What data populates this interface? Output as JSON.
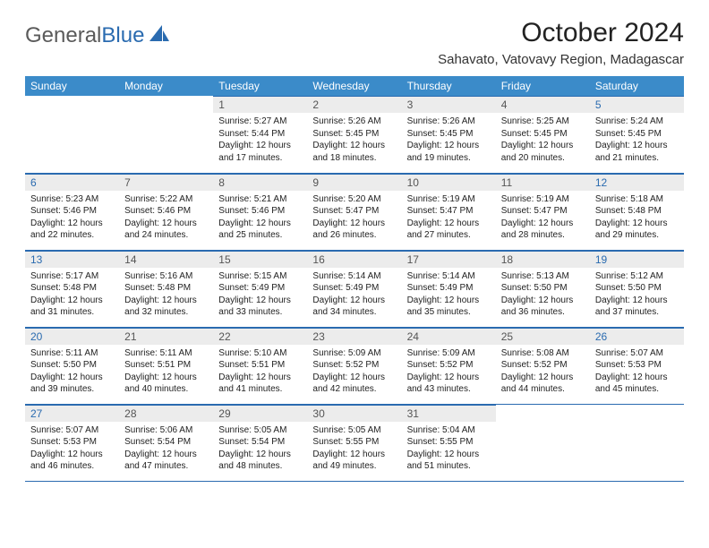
{
  "logo": {
    "part1": "General",
    "part2": "Blue"
  },
  "title": "October 2024",
  "location": "Sahavato, Vatovavy Region, Madagascar",
  "weekdays": [
    "Sunday",
    "Monday",
    "Tuesday",
    "Wednesday",
    "Thursday",
    "Friday",
    "Saturday"
  ],
  "weeks": [
    [
      {
        "day": "",
        "sunrise": "",
        "sunset": "",
        "daylight": ""
      },
      {
        "day": "",
        "sunrise": "",
        "sunset": "",
        "daylight": ""
      },
      {
        "day": "1",
        "sunrise": "Sunrise: 5:27 AM",
        "sunset": "Sunset: 5:44 PM",
        "daylight": "Daylight: 12 hours and 17 minutes."
      },
      {
        "day": "2",
        "sunrise": "Sunrise: 5:26 AM",
        "sunset": "Sunset: 5:45 PM",
        "daylight": "Daylight: 12 hours and 18 minutes."
      },
      {
        "day": "3",
        "sunrise": "Sunrise: 5:26 AM",
        "sunset": "Sunset: 5:45 PM",
        "daylight": "Daylight: 12 hours and 19 minutes."
      },
      {
        "day": "4",
        "sunrise": "Sunrise: 5:25 AM",
        "sunset": "Sunset: 5:45 PM",
        "daylight": "Daylight: 12 hours and 20 minutes."
      },
      {
        "day": "5",
        "sunrise": "Sunrise: 5:24 AM",
        "sunset": "Sunset: 5:45 PM",
        "daylight": "Daylight: 12 hours and 21 minutes."
      }
    ],
    [
      {
        "day": "6",
        "sunrise": "Sunrise: 5:23 AM",
        "sunset": "Sunset: 5:46 PM",
        "daylight": "Daylight: 12 hours and 22 minutes."
      },
      {
        "day": "7",
        "sunrise": "Sunrise: 5:22 AM",
        "sunset": "Sunset: 5:46 PM",
        "daylight": "Daylight: 12 hours and 24 minutes."
      },
      {
        "day": "8",
        "sunrise": "Sunrise: 5:21 AM",
        "sunset": "Sunset: 5:46 PM",
        "daylight": "Daylight: 12 hours and 25 minutes."
      },
      {
        "day": "9",
        "sunrise": "Sunrise: 5:20 AM",
        "sunset": "Sunset: 5:47 PM",
        "daylight": "Daylight: 12 hours and 26 minutes."
      },
      {
        "day": "10",
        "sunrise": "Sunrise: 5:19 AM",
        "sunset": "Sunset: 5:47 PM",
        "daylight": "Daylight: 12 hours and 27 minutes."
      },
      {
        "day": "11",
        "sunrise": "Sunrise: 5:19 AM",
        "sunset": "Sunset: 5:47 PM",
        "daylight": "Daylight: 12 hours and 28 minutes."
      },
      {
        "day": "12",
        "sunrise": "Sunrise: 5:18 AM",
        "sunset": "Sunset: 5:48 PM",
        "daylight": "Daylight: 12 hours and 29 minutes."
      }
    ],
    [
      {
        "day": "13",
        "sunrise": "Sunrise: 5:17 AM",
        "sunset": "Sunset: 5:48 PM",
        "daylight": "Daylight: 12 hours and 31 minutes."
      },
      {
        "day": "14",
        "sunrise": "Sunrise: 5:16 AM",
        "sunset": "Sunset: 5:48 PM",
        "daylight": "Daylight: 12 hours and 32 minutes."
      },
      {
        "day": "15",
        "sunrise": "Sunrise: 5:15 AM",
        "sunset": "Sunset: 5:49 PM",
        "daylight": "Daylight: 12 hours and 33 minutes."
      },
      {
        "day": "16",
        "sunrise": "Sunrise: 5:14 AM",
        "sunset": "Sunset: 5:49 PM",
        "daylight": "Daylight: 12 hours and 34 minutes."
      },
      {
        "day": "17",
        "sunrise": "Sunrise: 5:14 AM",
        "sunset": "Sunset: 5:49 PM",
        "daylight": "Daylight: 12 hours and 35 minutes."
      },
      {
        "day": "18",
        "sunrise": "Sunrise: 5:13 AM",
        "sunset": "Sunset: 5:50 PM",
        "daylight": "Daylight: 12 hours and 36 minutes."
      },
      {
        "day": "19",
        "sunrise": "Sunrise: 5:12 AM",
        "sunset": "Sunset: 5:50 PM",
        "daylight": "Daylight: 12 hours and 37 minutes."
      }
    ],
    [
      {
        "day": "20",
        "sunrise": "Sunrise: 5:11 AM",
        "sunset": "Sunset: 5:50 PM",
        "daylight": "Daylight: 12 hours and 39 minutes."
      },
      {
        "day": "21",
        "sunrise": "Sunrise: 5:11 AM",
        "sunset": "Sunset: 5:51 PM",
        "daylight": "Daylight: 12 hours and 40 minutes."
      },
      {
        "day": "22",
        "sunrise": "Sunrise: 5:10 AM",
        "sunset": "Sunset: 5:51 PM",
        "daylight": "Daylight: 12 hours and 41 minutes."
      },
      {
        "day": "23",
        "sunrise": "Sunrise: 5:09 AM",
        "sunset": "Sunset: 5:52 PM",
        "daylight": "Daylight: 12 hours and 42 minutes."
      },
      {
        "day": "24",
        "sunrise": "Sunrise: 5:09 AM",
        "sunset": "Sunset: 5:52 PM",
        "daylight": "Daylight: 12 hours and 43 minutes."
      },
      {
        "day": "25",
        "sunrise": "Sunrise: 5:08 AM",
        "sunset": "Sunset: 5:52 PM",
        "daylight": "Daylight: 12 hours and 44 minutes."
      },
      {
        "day": "26",
        "sunrise": "Sunrise: 5:07 AM",
        "sunset": "Sunset: 5:53 PM",
        "daylight": "Daylight: 12 hours and 45 minutes."
      }
    ],
    [
      {
        "day": "27",
        "sunrise": "Sunrise: 5:07 AM",
        "sunset": "Sunset: 5:53 PM",
        "daylight": "Daylight: 12 hours and 46 minutes."
      },
      {
        "day": "28",
        "sunrise": "Sunrise: 5:06 AM",
        "sunset": "Sunset: 5:54 PM",
        "daylight": "Daylight: 12 hours and 47 minutes."
      },
      {
        "day": "29",
        "sunrise": "Sunrise: 5:05 AM",
        "sunset": "Sunset: 5:54 PM",
        "daylight": "Daylight: 12 hours and 48 minutes."
      },
      {
        "day": "30",
        "sunrise": "Sunrise: 5:05 AM",
        "sunset": "Sunset: 5:55 PM",
        "daylight": "Daylight: 12 hours and 49 minutes."
      },
      {
        "day": "31",
        "sunrise": "Sunrise: 5:04 AM",
        "sunset": "Sunset: 5:55 PM",
        "daylight": "Daylight: 12 hours and 51 minutes."
      },
      {
        "day": "",
        "sunrise": "",
        "sunset": "",
        "daylight": ""
      },
      {
        "day": "",
        "sunrise": "",
        "sunset": "",
        "daylight": ""
      }
    ]
  ]
}
